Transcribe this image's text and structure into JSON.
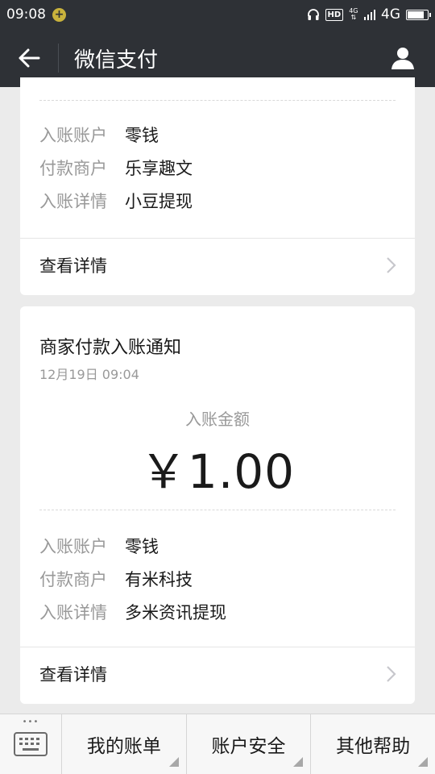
{
  "status_bar": {
    "time": "09:08",
    "hd": "HD",
    "network_small": "4G",
    "network": "4G"
  },
  "header": {
    "title": "微信支付"
  },
  "card_previous": {
    "rows": [
      {
        "label": "入账账户",
        "value": "零钱"
      },
      {
        "label": "付款商户",
        "value": "乐享趣文"
      },
      {
        "label": "入账详情",
        "value": "小豆提现"
      }
    ],
    "details_link": "查看详情"
  },
  "card_current": {
    "title": "商家付款入账通知",
    "time": "12月19日  09:04",
    "amount_label": "入账金额",
    "amount": "￥1.00",
    "rows": [
      {
        "label": "入账账户",
        "value": "零钱"
      },
      {
        "label": "付款商户",
        "value": "有米科技"
      },
      {
        "label": "入账详情",
        "value": "多米资讯提现"
      }
    ],
    "details_link": "查看详情"
  },
  "bottom_menu": {
    "items": [
      "我的账单",
      "账户安全",
      "其他帮助"
    ]
  },
  "colors": {
    "header_bg": "#2e3136",
    "page_bg": "#ebebeb",
    "muted_text": "#999999"
  }
}
